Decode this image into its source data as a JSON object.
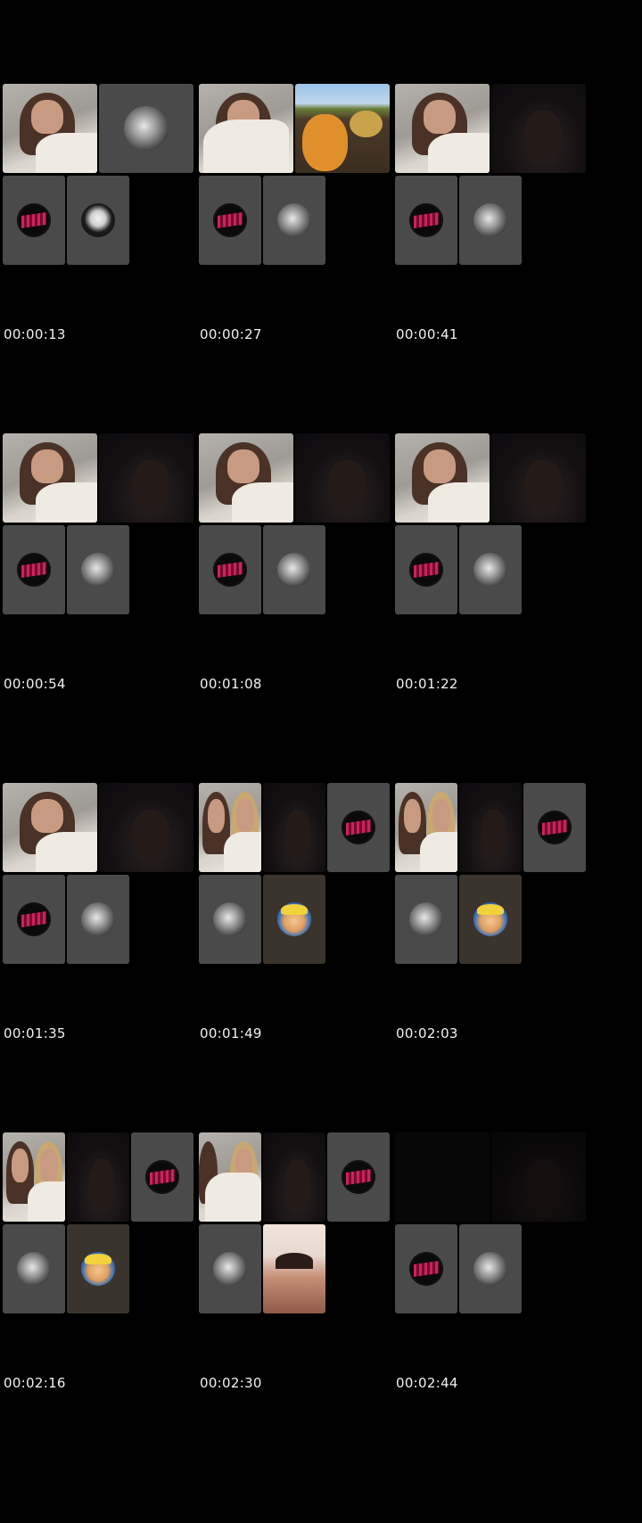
{
  "frames": [
    {
      "timestamp": "00:00:13"
    },
    {
      "timestamp": "00:00:27"
    },
    {
      "timestamp": "00:00:41"
    },
    {
      "timestamp": "00:00:54"
    },
    {
      "timestamp": "00:01:08"
    },
    {
      "timestamp": "00:01:22"
    },
    {
      "timestamp": "00:01:35"
    },
    {
      "timestamp": "00:01:49"
    },
    {
      "timestamp": "00:02:03"
    },
    {
      "timestamp": "00:02:16"
    },
    {
      "timestamp": "00:02:30"
    },
    {
      "timestamp": "00:02:44"
    }
  ],
  "colors": {
    "background": "#000000",
    "tile_grey": "#4a4a4a",
    "timestamp_text": "#f2f2f2",
    "avatar_red_accent": "#d0205a"
  },
  "icons": {
    "red_avatar": "red-grid-avatar",
    "silver_avatar": "silver-mask-avatar",
    "mask_avatar": "skull-mask-avatar",
    "naruto_avatar": "anime-face-avatar"
  }
}
